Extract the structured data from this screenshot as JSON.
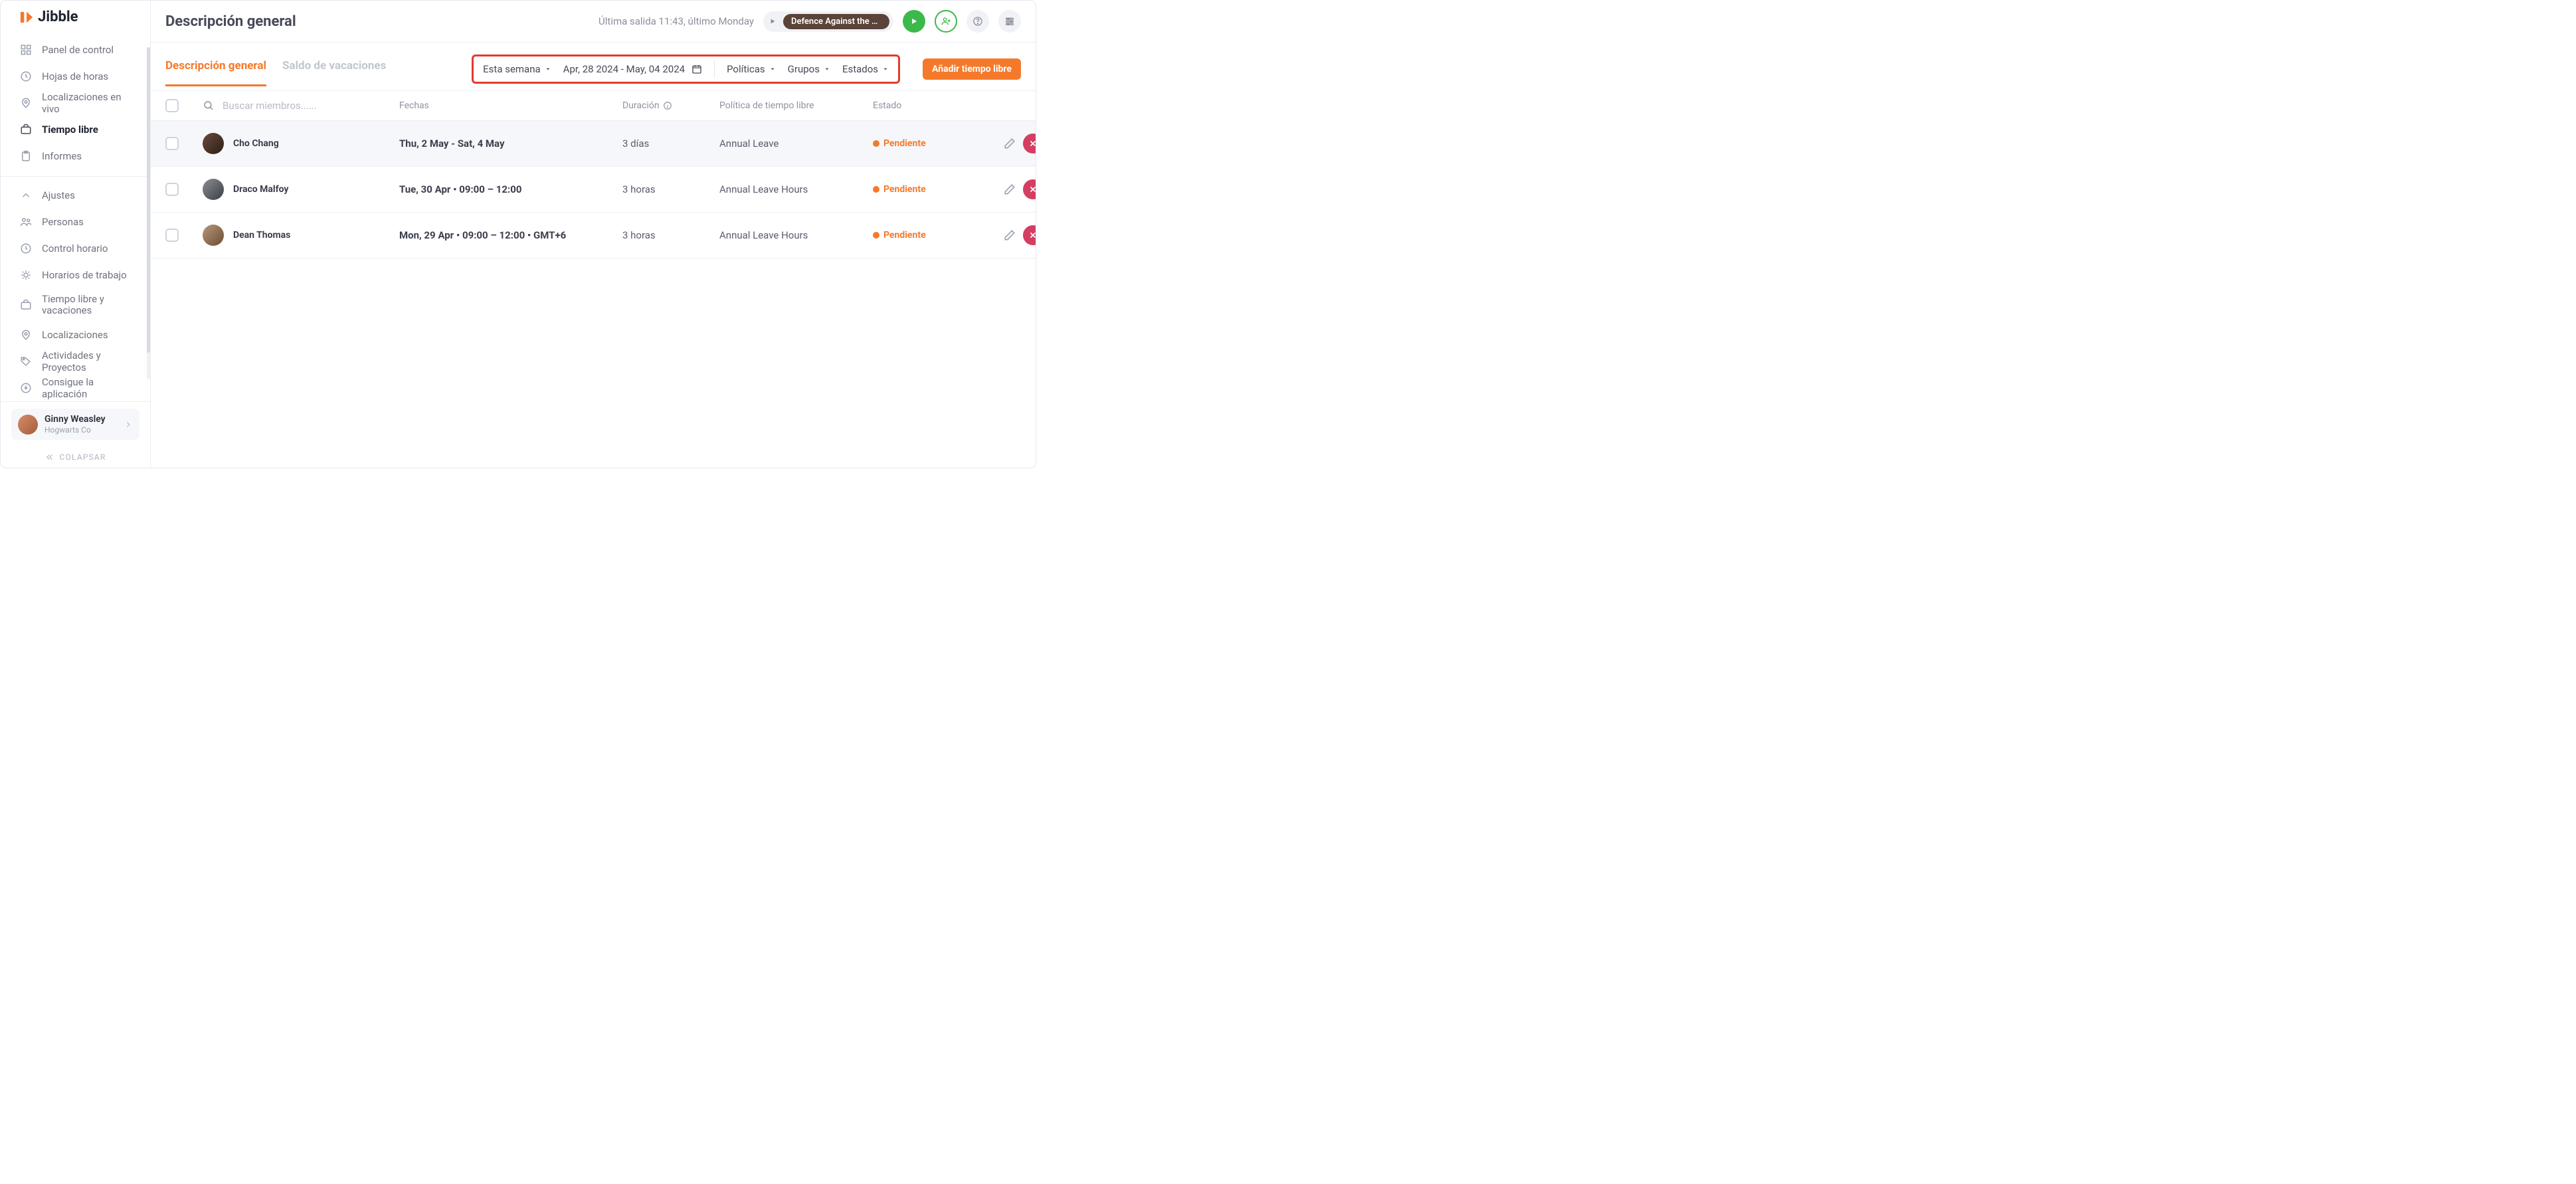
{
  "brand": {
    "name": "Jibble"
  },
  "sidebar": {
    "nav": [
      {
        "label": "Panel de control"
      },
      {
        "label": "Hojas de horas"
      },
      {
        "label": "Localizaciones en vivo"
      },
      {
        "label": "Tiempo libre"
      },
      {
        "label": "Informes"
      }
    ],
    "nav2": [
      {
        "label": "Ajustes"
      },
      {
        "label": "Personas"
      },
      {
        "label": "Control horario"
      },
      {
        "label": "Horarios de trabajo"
      },
      {
        "label": "Tiempo libre y vacaciones"
      },
      {
        "label": "Localizaciones"
      },
      {
        "label": "Actividades y Proyectos"
      },
      {
        "label": "Consigue la aplicación"
      }
    ],
    "user": {
      "name": "Ginny Weasley",
      "org": "Hogwarts Co"
    },
    "collapse": "COLAPSAR"
  },
  "topbar": {
    "title": "Descripción general",
    "status": "Última salida 11:43, último Monday",
    "activity": "Defence Against the Da…"
  },
  "tabs": {
    "overview": "Descripción general",
    "balance": "Saldo de vacaciones"
  },
  "filters": {
    "period": "Esta semana",
    "range": "Apr, 28 2024 - May, 04 2024",
    "policies": "Políticas",
    "groups": "Grupos",
    "states": "Estados"
  },
  "actions": {
    "add": "Añadir tiempo libre"
  },
  "table": {
    "searchPlaceholder": "Buscar miembros......",
    "headers": {
      "dates": "Fechas",
      "duration": "Duración",
      "policy": "Política de tiempo libre",
      "state": "Estado"
    },
    "rows": [
      {
        "name": "Cho Chang",
        "dates": "Thu, 2 May - Sat, 4 May",
        "duration": "3 días",
        "policy": "Annual Leave",
        "state": "Pendiente"
      },
      {
        "name": "Draco Malfoy",
        "dates": "Tue, 30 Apr • 09:00 – 12:00",
        "duration": "3 horas",
        "policy": "Annual Leave Hours",
        "state": "Pendiente"
      },
      {
        "name": "Dean Thomas",
        "dates": "Mon, 29 Apr • 09:00 – 12:00 • GMT+6",
        "duration": "3 horas",
        "policy": "Annual Leave Hours",
        "state": "Pendiente"
      }
    ]
  }
}
